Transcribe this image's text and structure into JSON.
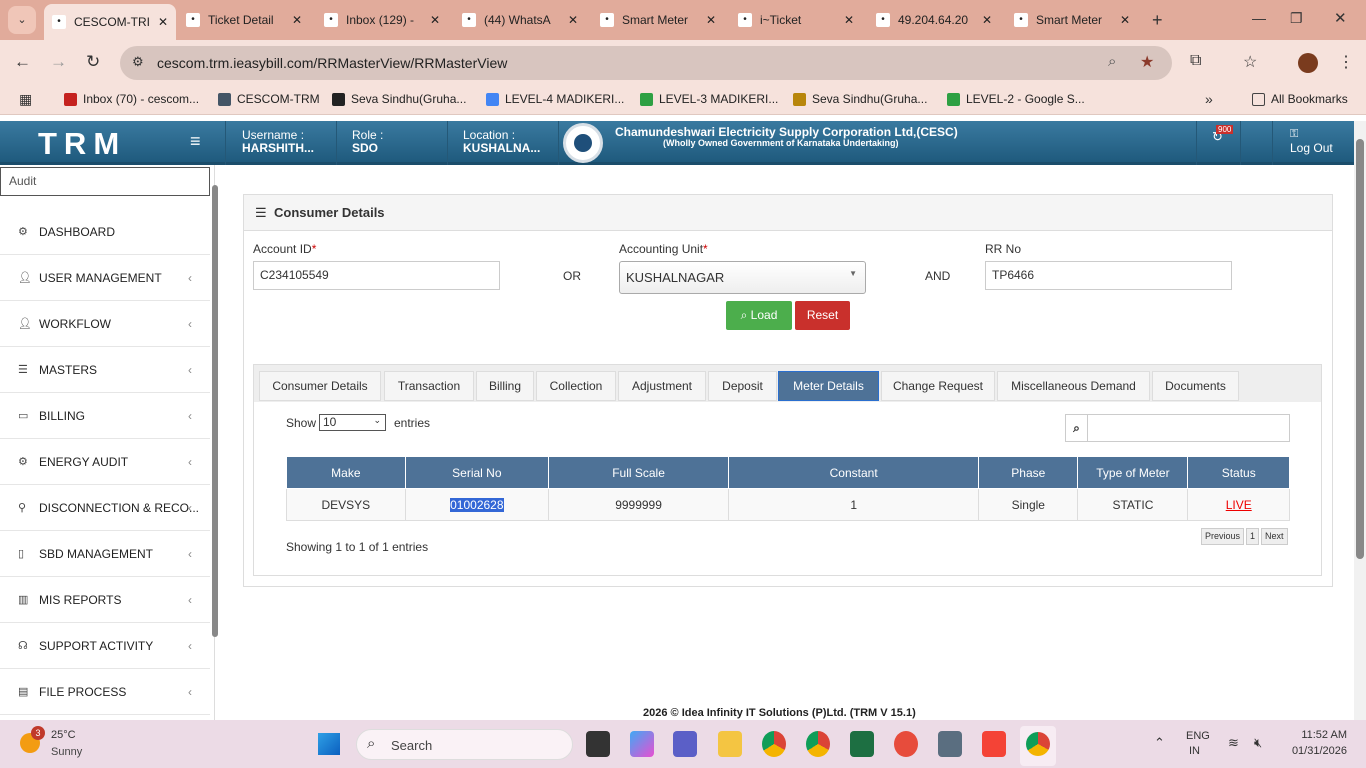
{
  "browser": {
    "tabs": [
      {
        "label": "CESCOM-TRI",
        "active": true
      },
      {
        "label": "Ticket Detail"
      },
      {
        "label": "Inbox (129) -"
      },
      {
        "label": "(44) WhatsA"
      },
      {
        "label": "Smart Meter"
      },
      {
        "label": "i~Ticket"
      },
      {
        "label": "49.204.64.20"
      },
      {
        "label": "Smart Meter"
      }
    ],
    "url": "cescom.trm.ieasybill.com/RRMasterView/RRMasterView",
    "bookmarks": [
      "Inbox (70) - cescom...",
      "CESCOM-TRM",
      "Seva Sindhu(Gruha...",
      "LEVEL-4 MADIKERI...",
      "LEVEL-3 MADIKERI...",
      "Seva Sindhu(Gruha...",
      "LEVEL-2 - Google S..."
    ],
    "all_bookmarks": "All Bookmarks"
  },
  "header": {
    "logo": "TRM",
    "username_label": "Username :",
    "username": "HARSHITH...",
    "role_label": "Role :",
    "role": "SDO",
    "location_label": "Location :",
    "location": "KUSHALNA...",
    "org": "Chamundeshwari Electricity Supply Corporation Ltd,(CESC)",
    "org_sub": "(Wholly Owned Government of Karnataka Undertaking)",
    "notif_count": "900",
    "logout": "Log Out"
  },
  "sidebar": {
    "search_value": "Audit",
    "items": [
      "DASHBOARD",
      "USER MANAGEMENT",
      "WORKFLOW",
      "MASTERS",
      "BILLING",
      "ENERGY AUDIT",
      "DISCONNECTION & RECO...",
      "SBD MANAGEMENT",
      "MIS REPORTS",
      "SUPPORT ACTIVITY",
      "FILE PROCESS"
    ]
  },
  "panel": {
    "title": "Consumer Details",
    "account_label": "Account ID",
    "account_value": "C234105549",
    "or": "OR",
    "unit_label": "Accounting Unit",
    "unit_value": "KUSHALNAGAR",
    "and": "AND",
    "rr_label": "RR No",
    "rr_value": "TP6466",
    "required": "*",
    "load": "Load",
    "reset": "Reset",
    "tabs": [
      "Consumer Details",
      "Transaction",
      "Billing",
      "Collection",
      "Adjustment",
      "Deposit",
      "Meter Details",
      "Change Request",
      "Miscellaneous Demand",
      "Documents"
    ],
    "active_tab": "Meter Details",
    "show": "Show",
    "entries_value": "10",
    "entries": "entries",
    "columns": [
      "Make",
      "Serial No",
      "Full Scale",
      "Constant",
      "Phase",
      "Type of Meter",
      "Status"
    ],
    "rows": [
      [
        "DEVSYS",
        "01002628",
        "9999999",
        "1",
        "Single",
        "STATIC",
        "LIVE"
      ]
    ],
    "info": "Showing 1 to 1 of 1 entries",
    "prev": "Previous",
    "page": "1",
    "next": "Next"
  },
  "footer": "2026 © Idea Infinity IT Solutions (P)Ltd. (TRM V 15.1)",
  "taskbar": {
    "temp": "25°C",
    "weather": "Sunny",
    "weather_badge": "3",
    "search": "Search",
    "lang1": "ENG",
    "lang2": "IN",
    "time": "11:52 AM",
    "date": "01/31/2026"
  }
}
